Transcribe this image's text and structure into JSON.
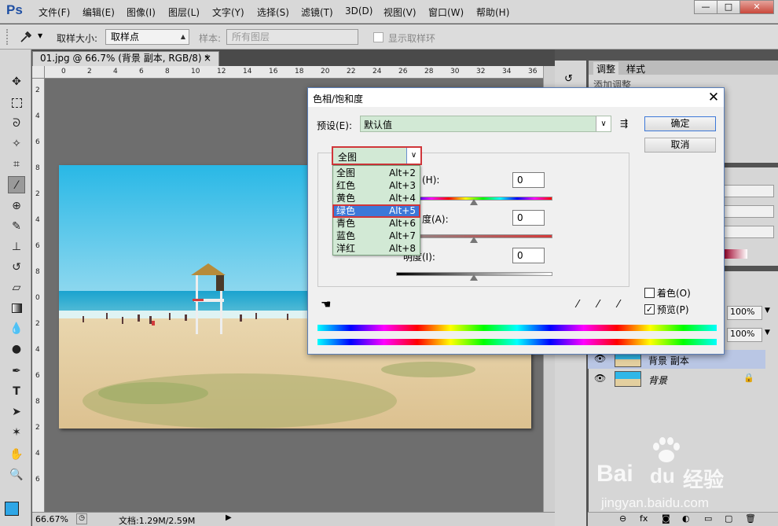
{
  "menubar": {
    "logo": "Ps",
    "items": [
      "文件(F)",
      "编辑(E)",
      "图像(I)",
      "图层(L)",
      "文字(Y)",
      "选择(S)",
      "滤镜(T)",
      "3D(D)",
      "视图(V)",
      "窗口(W)",
      "帮助(H)"
    ],
    "window_buttons": [
      "—",
      "□",
      "✕"
    ]
  },
  "options": {
    "sample_size_label": "取样大小:",
    "sample_size_value": "取样点",
    "sample_label": "样本:",
    "sample_value": "所有图层",
    "show_ring_label": "显示取样环"
  },
  "document": {
    "tab_label": "01.jpg @ 66.7% (背景 副本, RGB/8) *",
    "tab_close": "×",
    "ruler_top": [
      "0",
      "2",
      "4",
      "6",
      "8",
      "10",
      "12",
      "14",
      "16",
      "18",
      "20",
      "22",
      "24",
      "26",
      "28",
      "30",
      "32",
      "34",
      "36"
    ],
    "ruler_left": [
      "2",
      "4",
      "6",
      "8",
      "2",
      "4",
      "6",
      "8",
      "0",
      "2",
      "4",
      "6",
      "8",
      "2",
      "4",
      "6"
    ],
    "zoom": "66.67%",
    "status": "文档:1.29M/2.59M"
  },
  "dialog": {
    "title": "色相/饱和度",
    "close": "✕",
    "preset_label": "预设(E):",
    "preset_value": "默认值",
    "ok": "确定",
    "cancel": "取消",
    "channel_value": "全图",
    "hue_label": "(H):",
    "saturation_label": "度(A):",
    "lightness_label": "明度(I):",
    "hue_value": "0",
    "saturation_value": "0",
    "lightness_value": "0",
    "colorize_label": "着色(O)",
    "preview_label": "预览(P)",
    "preview_checked": true,
    "colorize_checked": false,
    "dropdown_items": [
      {
        "label": "全图",
        "shortcut": "Alt+2"
      },
      {
        "label": "红色",
        "shortcut": "Alt+3"
      },
      {
        "label": "黄色",
        "shortcut": "Alt+4"
      },
      {
        "label": "绿色",
        "shortcut": "Alt+5"
      },
      {
        "label": "青色",
        "shortcut": "Alt+6"
      },
      {
        "label": "蓝色",
        "shortcut": "Alt+7"
      },
      {
        "label": "洋红",
        "shortcut": "Alt+8"
      }
    ],
    "selected_item": "绿色"
  },
  "right_panel": {
    "tab_adjustments": "调整",
    "tab_styles": "样式",
    "add_adjustment": "添加调整",
    "opacity_1": "100%",
    "opacity_2": "100%",
    "layers": [
      {
        "name": "背景 副本",
        "locked": false
      },
      {
        "name": "背景",
        "locked": true
      }
    ]
  },
  "watermark": {
    "brand": "Bai",
    "brand2": "du",
    "brand_cn": "经验",
    "url": "jingyan.baidu.com"
  },
  "colors": {
    "accent": "#3c78d8",
    "highlight_border": "#d0363a",
    "dropdown_bg": "#d2e9d5"
  }
}
